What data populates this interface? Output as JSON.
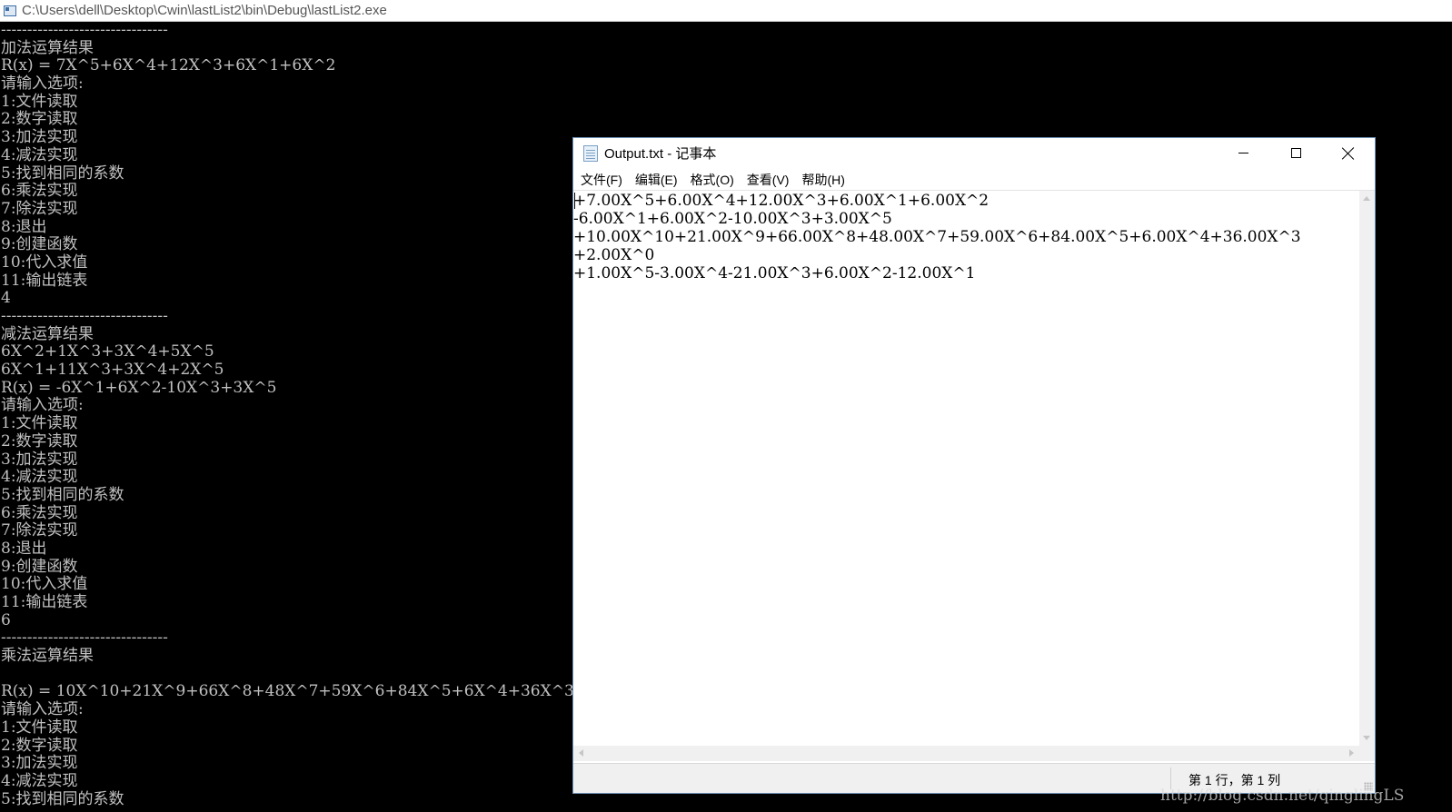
{
  "console": {
    "title": "C:\\Users\\dell\\Desktop\\Cwin\\lastList2\\bin\\Debug\\lastList2.exe",
    "lines": [
      "--------------------------------",
      "加法运算结果",
      "R(x) = 7X^5+6X^4+12X^3+6X^1+6X^2",
      "请输入选项:",
      "1:文件读取",
      "2:数字读取",
      "3:加法实现",
      "4:减法实现",
      "5:找到相同的系数",
      "6:乘法实现",
      "7:除法实现",
      "8:退出",
      "9:创建函数",
      "10:代入求值",
      "11:输出链表",
      "4",
      "--------------------------------",
      "减法运算结果",
      "6X^2+1X^3+3X^4+5X^5",
      "6X^1+11X^3+3X^4+2X^5",
      "R(x) = -6X^1+6X^2-10X^3+3X^5",
      "请输入选项:",
      "1:文件读取",
      "2:数字读取",
      "3:加法实现",
      "4:减法实现",
      "5:找到相同的系数",
      "6:乘法实现",
      "7:除法实现",
      "8:退出",
      "9:创建函数",
      "10:代入求值",
      "11:输出链表",
      "6",
      "--------------------------------",
      "乘法运算结果",
      "",
      "R(x) = 10X^10+21X^9+66X^8+48X^7+59X^6+84X^5+6X^4+36X^3",
      "请输入选项:",
      "1:文件读取",
      "2:数字读取",
      "3:加法实现",
      "4:减法实现",
      "5:找到相同的系数"
    ]
  },
  "notepad": {
    "title": "Output.txt - 记事本",
    "menu": [
      "文件(F)",
      "编辑(E)",
      "格式(O)",
      "查看(V)",
      "帮助(H)"
    ],
    "content": [
      "+7.00X^5+6.00X^4+12.00X^3+6.00X^1+6.00X^2",
      "-6.00X^1+6.00X^2-10.00X^3+3.00X^5",
      "+10.00X^10+21.00X^9+66.00X^8+48.00X^7+59.00X^6+84.00X^5+6.00X^4+36.00X^3",
      "+2.00X^0",
      "+1.00X^5-3.00X^4-21.00X^3+6.00X^2-12.00X^1"
    ],
    "status": "第 1 行，第 1 列"
  },
  "watermark": "http://blog.csdn.net/qinglingLS"
}
